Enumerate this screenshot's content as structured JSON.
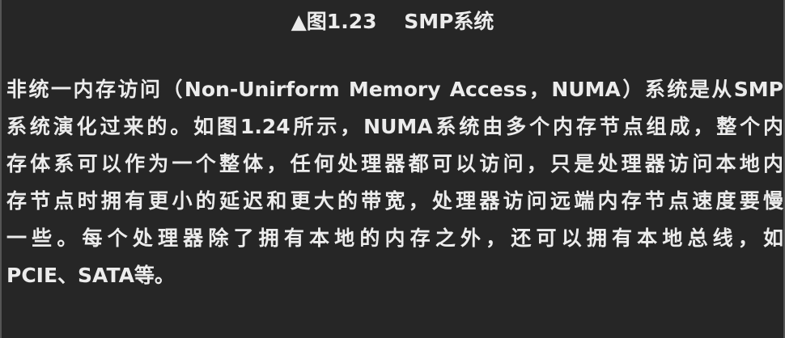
{
  "caption": "▲图1.23　 SMP系统",
  "paragraph_lines": [
    "非统一内存访问（Non-Unirform Memory Access，NUMA）系统是从SMP",
    "系统演化过来的。如图1.24所示，NUMA系统由多个内存节点组成，整个内",
    "存体系可以作为一个整体，任何处理器都可以访问，只是处理器访问本地内",
    "存节点时拥有更小的延迟和更大的带宽，处理器访问远端内存节点速度要慢",
    "一些。每个处理器除了拥有本地的内存之外，还可以拥有本地总线，如",
    "PCIE、SATA等。"
  ],
  "colors": {
    "background": "#262626",
    "text": "#ececec",
    "side_border": "#555555"
  }
}
